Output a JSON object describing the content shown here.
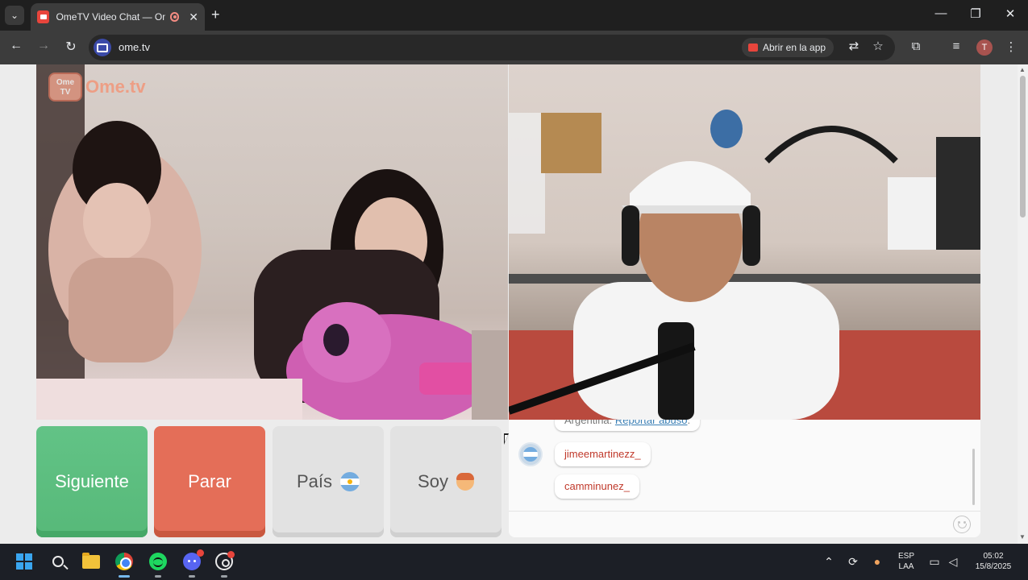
{
  "browser": {
    "tab": {
      "title": "OmeTV Video Chat — Ome"
    },
    "address": {
      "url": "ome.tv"
    },
    "open_in_app_label": "Abrir en la app",
    "profile_initial": "T"
  },
  "icons": {
    "tab_search": "chevron-down-icon",
    "close": "close-icon",
    "new_tab": "plus-icon",
    "back": "arrow-left-icon",
    "forward": "arrow-right-icon",
    "reload": "reload-icon",
    "translate": "translate-icon",
    "bookmark": "star-icon",
    "extensions": "puzzle-icon",
    "media": "media-controls-icon",
    "menu": "kebab-menu-icon"
  },
  "app": {
    "logo": {
      "badge_line1": "Ome",
      "badge_line2": "TV",
      "text": "Ome.tv"
    },
    "buttons": {
      "next": "Siguiente",
      "stop": "Parar",
      "country": "País",
      "gender": "Soy"
    },
    "chat": {
      "clipped_prefix": "Argentina.",
      "clipped_link": "Reportar abuso",
      "clipped_suffix": ".",
      "messages": [
        {
          "user": "jimeemartinezz_"
        },
        {
          "user": "camminunez_"
        }
      ]
    },
    "colors": {
      "next": "#5cbf80",
      "stop": "#e46e58",
      "neutral": "#e2e2e2",
      "chat_name": "#c0392b"
    }
  },
  "taskbar": {
    "language": "ESP",
    "layout": "LAA",
    "time": "05:02",
    "date": "15/8/2025"
  }
}
